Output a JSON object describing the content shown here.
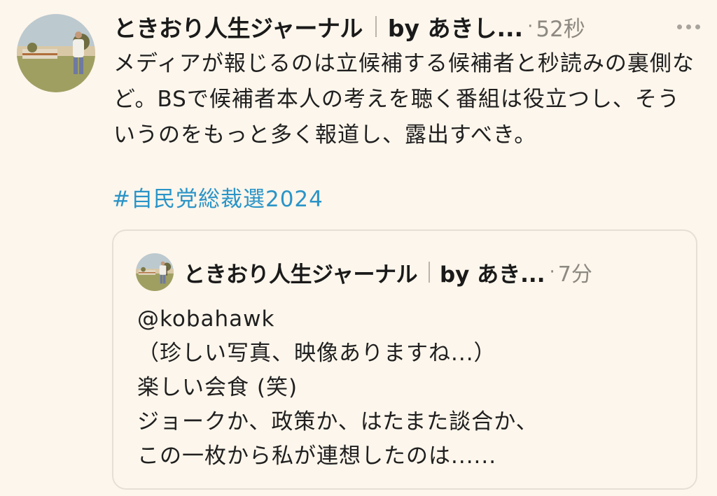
{
  "tweet": {
    "author_name": "ときおり人生ジャーナル",
    "author_sub": "by あきし...",
    "separator_dot": "·",
    "time": "52秒",
    "body": "メディアが報じるのは立候補する候補者と秒読みの裏側など。BSで候補者本人の考えを聴く番組は役立つし、そういうのをもっと多く報道し、露出すべき。",
    "hashtag": "#自民党総裁選2024",
    "more_icon": "ellipsis-icon"
  },
  "quote": {
    "author_name": "ときおり人生ジャーナル",
    "author_sub": "by あき...",
    "separator_dot": "·",
    "time": "7分",
    "lines": [
      "@kobahawk",
      "（珍しい写真、映像ありますね...）",
      "楽しい会食 (笑)",
      "ジョークか、政策か、はたまた談合か、",
      "この一枚から私が連想したのは......"
    ]
  },
  "colors": {
    "background": "#fdf6ec",
    "hashtag": "#2a94c7",
    "muted": "#8d8982",
    "border": "#e6dfd5"
  }
}
